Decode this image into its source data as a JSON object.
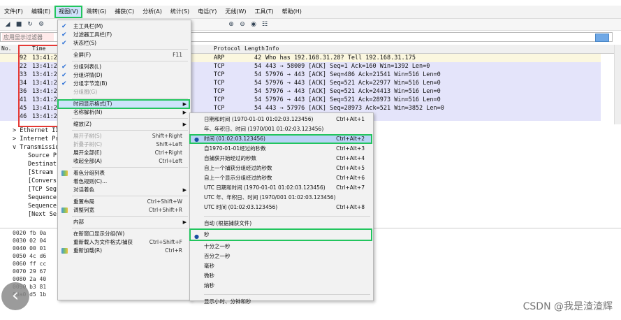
{
  "menubar": {
    "items": [
      "文件(F)",
      "编辑(E)",
      "视图(V)",
      "跳转(G)",
      "捕获(C)",
      "分析(A)",
      "统计(S)",
      "电话(Y)",
      "无线(W)",
      "工具(T)",
      "帮助(H)"
    ],
    "active_index": 2
  },
  "toolbar": {
    "icons": [
      "shark-fin-icon",
      "stop-icon",
      "restart-icon",
      "options-icon",
      "zoom-in-icon",
      "zoom-out-icon",
      "zoom-reset-icon",
      "resize-columns-icon"
    ]
  },
  "filter": {
    "placeholder": "应用显示过滤器"
  },
  "packet_list": {
    "columns": [
      "No.",
      "Time",
      "Protocol",
      "Length",
      "Info"
    ],
    "rows": [
      {
        "no": "92",
        "time": "13:41:2",
        "protocol": "ARP",
        "length": "42",
        "info": "Who has 192.168.31.28? Tell 192.168.31.175",
        "type": "arp"
      },
      {
        "no": "22",
        "time": "13:41:2",
        "protocol": "TCP",
        "length": "54",
        "info": "443 → 58009 [ACK] Seq=1 Ack=160 Win=1392 Len=0",
        "type": "tcp"
      },
      {
        "no": "33",
        "time": "13:41:2",
        "protocol": "TCP",
        "length": "54",
        "info": "57976 → 443 [ACK] Seq=486 Ack=21541 Win=516 Len=0",
        "type": "tcp"
      },
      {
        "no": "34",
        "time": "13:41:2",
        "protocol": "TCP",
        "length": "54",
        "info": "57976 → 443 [ACK] Seq=521 Ack=22977 Win=516 Len=0",
        "type": "tcp"
      },
      {
        "no": "36",
        "time": "13:41:2",
        "protocol": "TCP",
        "length": "54",
        "info": "57976 → 443 [ACK] Seq=521 Ack=24413 Win=516 Len=0",
        "type": "tcp"
      },
      {
        "no": "41",
        "time": "13:41:2",
        "protocol": "TCP",
        "length": "54",
        "info": "57976 → 443 [ACK] Seq=521 Ack=28973 Win=516 Len=0",
        "type": "tcp"
      },
      {
        "no": "45",
        "time": "13:41:2",
        "protocol": "TCP",
        "length": "54",
        "info": "443 → 57976 [ACK] Seq=28973 Ack=521 Win=3852 Len=0",
        "type": "tcp"
      },
      {
        "no": "46",
        "time": "13:41:2",
        "protocol": "TCP",
        "length": "54",
        "info": "8 Win=1392 Len=0",
        "type": "tcp"
      }
    ]
  },
  "details": {
    "rows": [
      {
        "prefix": ">",
        "text": "Ethernet II"
      },
      {
        "prefix": ">",
        "text": "Internet Pr"
      },
      {
        "prefix": "v",
        "text": "Transmissio"
      },
      {
        "prefix": "",
        "text": "Source P"
      },
      {
        "prefix": "",
        "text": "Destinat"
      },
      {
        "prefix": "",
        "text": "[Stream"
      },
      {
        "prefix": "",
        "text": "[Convers"
      },
      {
        "prefix": "",
        "text": "[TCP Seg"
      },
      {
        "prefix": "",
        "text": "Sequence"
      },
      {
        "prefix": "",
        "text": "Sequence"
      },
      {
        "prefix": "",
        "text": "[Next Se"
      }
    ]
  },
  "hex": {
    "rows": [
      {
        "offset": "0020",
        "bytes": "fb 0a"
      },
      {
        "offset": "0030",
        "bytes": "02 04"
      },
      {
        "offset": "0040",
        "bytes": "00 01"
      },
      {
        "offset": "0050",
        "bytes": "4c d6"
      },
      {
        "offset": "0060",
        "bytes": "ff cc"
      },
      {
        "offset": "0070",
        "bytes": "29 67"
      },
      {
        "offset": "0080",
        "bytes": "2a 40"
      },
      {
        "offset": "0090",
        "bytes": "b3 81"
      },
      {
        "offset": "00a0",
        "bytes": "d5 1b"
      }
    ]
  },
  "view_menu": {
    "items": [
      {
        "label": "主工具栏(M)",
        "checked": true
      },
      {
        "label": "过滤器工具栏(F)",
        "checked": true
      },
      {
        "label": "状态栏(S)",
        "checked": true
      },
      {
        "sep": true
      },
      {
        "label": "全屏(F)",
        "shortcut": "F11"
      },
      {
        "sep": true
      },
      {
        "label": "分组列表(L)",
        "checked": true
      },
      {
        "label": "分组详情(D)",
        "checked": true
      },
      {
        "label": "分组字节流(B)",
        "checked": true
      },
      {
        "label": "分组图(G)",
        "disabled": true
      },
      {
        "sep": true
      },
      {
        "label": "时间显示格式(T)",
        "submenu": true,
        "highlighted": true
      },
      {
        "label": "名称解析(N)",
        "submenu": true
      },
      {
        "sep": true
      },
      {
        "label": "缩放(Z)",
        "submenu": true
      },
      {
        "sep": true
      },
      {
        "label": "展开子树(S)",
        "shortcut": "Shift+Right",
        "disabled": true
      },
      {
        "label": "折叠子树(C)",
        "shortcut": "Shift+Left",
        "disabled": true
      },
      {
        "label": "展开全部(E)",
        "shortcut": "Ctrl+Right"
      },
      {
        "label": "收起全部(A)",
        "shortcut": "Ctrl+Left"
      },
      {
        "sep": true
      },
      {
        "label": "着色分组列表",
        "icon": true
      },
      {
        "label": "着色规则(C)..."
      },
      {
        "label": "对话着色",
        "submenu": true
      },
      {
        "sep": true
      },
      {
        "label": "重置布局",
        "shortcut": "Ctrl+Shift+W"
      },
      {
        "label": "调整列宽",
        "shortcut": "Ctrl+Shift+R",
        "icon": true
      },
      {
        "sep": true
      },
      {
        "label": "内部",
        "submenu": true
      },
      {
        "sep": true
      },
      {
        "label": "在新窗口显示分组(W)"
      },
      {
        "label": "重新载入为文件格式/捕获",
        "shortcut": "Ctrl+Shift+F"
      },
      {
        "label": "重新加载(R)",
        "shortcut": "Ctrl+R",
        "icon": true
      }
    ]
  },
  "time_format_menu": {
    "items": [
      {
        "label": "日期和时间 (1970-01-01 01:02:03.123456)",
        "shortcut": "Ctrl+Alt+1"
      },
      {
        "label": "年、年积日、时间 (1970/001 01:02:03.123456)"
      },
      {
        "label": "时间 (01:02:03.123456)",
        "shortcut": "Ctrl+Alt+2",
        "selected": true,
        "highlighted": true
      },
      {
        "label": "自1970-01-01经过的秒数",
        "shortcut": "Ctrl+Alt+3"
      },
      {
        "label": "自捕获开始经过的秒数",
        "shortcut": "Ctrl+Alt+4"
      },
      {
        "label": "自上一个捕获分组经过的秒数",
        "shortcut": "Ctrl+Alt+5"
      },
      {
        "label": "自上一个显示分组经过的秒数",
        "shortcut": "Ctrl+Alt+6"
      },
      {
        "label": "UTC 日期和时间 (1970-01-01 01:02:03.123456)",
        "shortcut": "Ctrl+Alt+7"
      },
      {
        "label": "UTC 年、年积日、时间 (1970/001 01:02:03.123456)"
      },
      {
        "label": "UTC 时间 (01:02:03.123456)",
        "shortcut": "Ctrl+Alt+8"
      },
      {
        "sep": true
      },
      {
        "label": "自动 (根据捕获文件)"
      },
      {
        "label": "秒",
        "selected": true,
        "boxed": true
      },
      {
        "label": "十分之一秒"
      },
      {
        "label": "百分之一秒"
      },
      {
        "label": "毫秒"
      },
      {
        "label": "微秒"
      },
      {
        "label": "纳秒"
      },
      {
        "sep": true
      },
      {
        "label": "显示小时、分钟和秒"
      }
    ]
  },
  "watermark": "CSDN @我是渣渣辉",
  "colors": {
    "accent_green": "#22c55e",
    "highlight_red": "#e53935",
    "arp_row": "#fbf7df",
    "tcp_row": "#e4e4fa"
  }
}
